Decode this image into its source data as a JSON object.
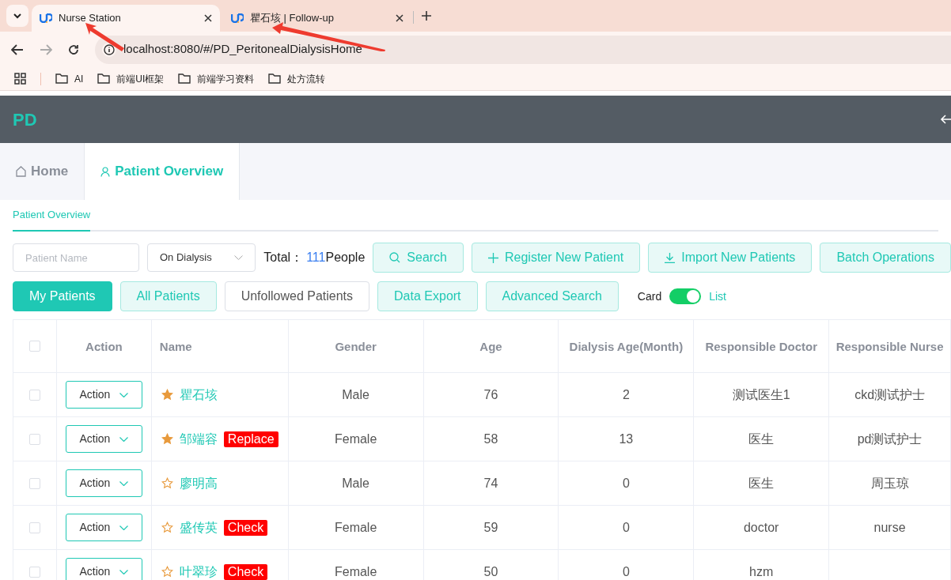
{
  "browser": {
    "tabs": [
      {
        "title": "Nurse Station",
        "selected": true
      },
      {
        "title": "瞿石垓 | Follow-up",
        "selected": false
      }
    ],
    "address": "localhost:8080/#/PD_PeritonealDialysisHome",
    "bookmarks": [
      "AI",
      "前端UI框架",
      "前端学习资料",
      "处方流转"
    ]
  },
  "app": {
    "logo": "PD",
    "nav_tabs": [
      {
        "label": "Home",
        "selected": false
      },
      {
        "label": "Patient Overview",
        "selected": true
      }
    ],
    "sub_tab": {
      "label": "Patient Overview",
      "selected": true
    },
    "filters": {
      "name": {
        "placeholder": "Patient Name"
      },
      "status": {
        "value": "On Dialysis"
      },
      "total_label": "Total：",
      "total_count": "111",
      "total_unit": "People"
    },
    "actions": [
      {
        "label": "Search",
        "kind": "light"
      },
      {
        "label": "Register New Patient",
        "kind": "light"
      },
      {
        "label": "Import New Patients",
        "kind": "light"
      },
      {
        "label": "Batch Operations",
        "kind": "light"
      }
    ],
    "views": [
      {
        "label": "My Patients",
        "kind": "primary"
      },
      {
        "label": "All Patients",
        "kind": "light"
      },
      {
        "label": "Unfollowed Patients",
        "kind": "plain"
      },
      {
        "label": "Data Export",
        "kind": "light"
      },
      {
        "label": "Advanced Search",
        "kind": "light"
      }
    ],
    "view_toggle": {
      "left": "Card",
      "right": "List",
      "on": true
    },
    "table": {
      "select_all_checked": false,
      "columns": [
        "Action",
        "Name",
        "Gender",
        "Age",
        "Dialysis Age(Month)",
        "Responsible Doctor",
        "Responsible Nurse"
      ],
      "rows": [
        {
          "checked": false,
          "action": "Action",
          "name": "瞿石垓",
          "starred": true,
          "gender": "Male",
          "age": "76",
          "dialysis_months": "2",
          "doctor": "测试医生1",
          "nurse": "ckd测试护士"
        },
        {
          "checked": false,
          "action": "Action",
          "name": "邹端容",
          "starred": true,
          "tag": "Replace",
          "gender": "Female",
          "age": "58",
          "dialysis_months": "13",
          "doctor": "医生",
          "nurse": "pd测试护士"
        },
        {
          "checked": false,
          "action": "Action",
          "name": "廖明高",
          "starred": false,
          "gender": "Male",
          "age": "74",
          "dialysis_months": "0",
          "doctor": "医生",
          "nurse": "周玉琼"
        },
        {
          "checked": false,
          "action": "Action",
          "name": "盛传英",
          "starred": false,
          "tag": "Check",
          "gender": "Female",
          "age": "59",
          "dialysis_months": "0",
          "doctor": "doctor",
          "nurse": "nurse"
        },
        {
          "checked": false,
          "action": "Action",
          "name": "叶翠珍",
          "starred": false,
          "tag": "Check",
          "gender": "Female",
          "age": "50",
          "dialysis_months": "0",
          "doctor": "hzm"
        }
      ]
    }
  }
}
